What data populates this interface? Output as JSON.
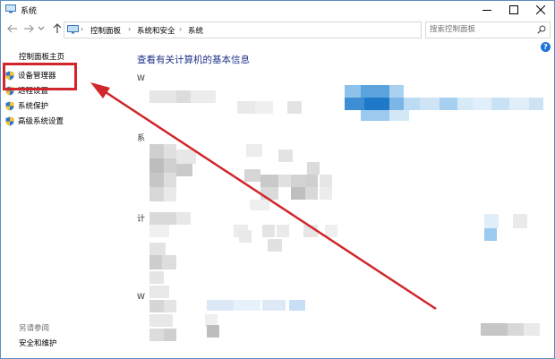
{
  "window": {
    "title": "系统"
  },
  "address_bar": {
    "breadcrumbs": [
      "控制面板",
      "系统和安全",
      "系统"
    ]
  },
  "search": {
    "placeholder": "搜索控制面板"
  },
  "sidebar": {
    "home_link": "控制面板主页",
    "items": [
      {
        "label": "设备管理器"
      },
      {
        "label": "远程设置"
      },
      {
        "label": "系统保护"
      },
      {
        "label": "高级系统设置"
      }
    ],
    "see_also_heading": "另请参阅",
    "see_also_items": [
      {
        "label": "安全和维护"
      }
    ]
  },
  "main": {
    "title": "查看有关计算机的基本信息",
    "section_letters": [
      "W",
      "系",
      "计",
      "W"
    ]
  },
  "annotation": {
    "color": "#d1262b"
  },
  "colors": {
    "title_blue": "#1e3287",
    "window_border": "#5b8ec4",
    "help_blue": "#1e74d6"
  }
}
